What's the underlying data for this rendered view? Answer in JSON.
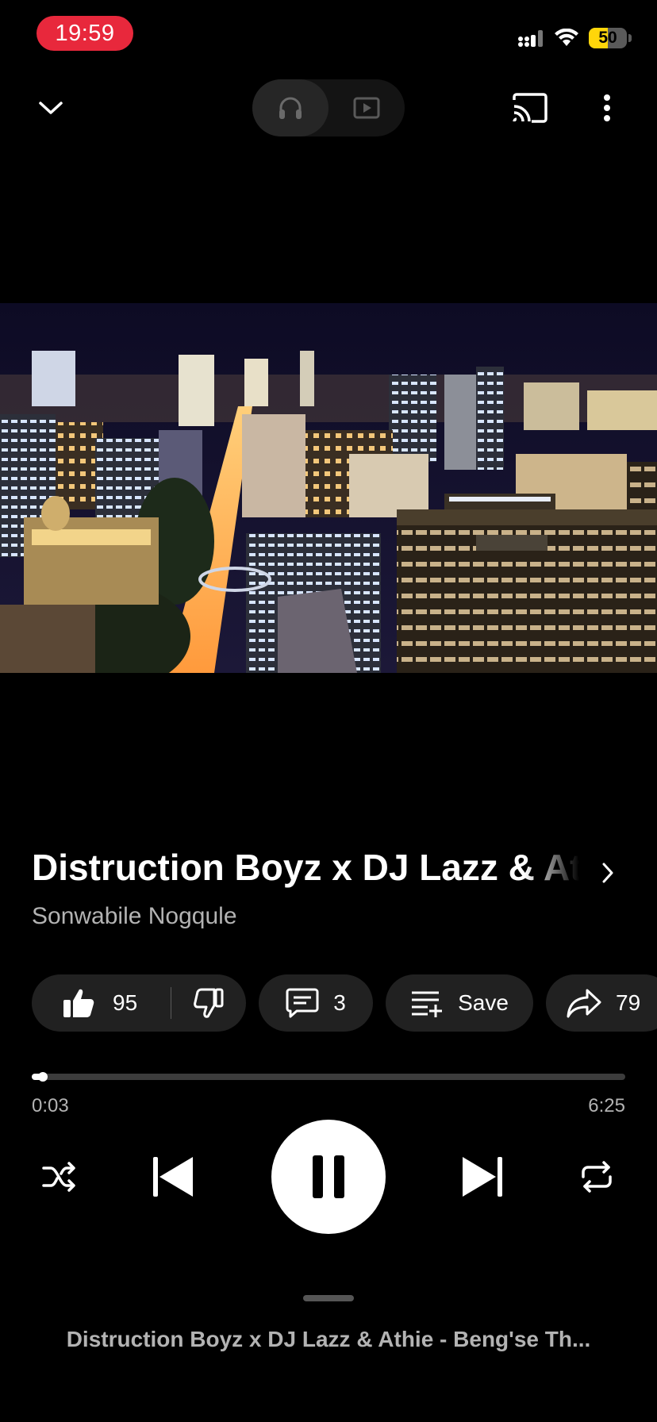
{
  "status_bar": {
    "time": "19:59",
    "battery_level": "50",
    "battery_fraction": 0.5,
    "battery_color": "#ffd60a",
    "time_pill_color": "#e8283c"
  },
  "toolbar": {
    "collapse_icon": "chevron-down-icon",
    "modes": [
      {
        "icon": "headphones-icon",
        "selected": true
      },
      {
        "icon": "video-icon",
        "selected": false
      }
    ],
    "cast_icon": "cast-icon",
    "more_icon": "more-vertical-icon"
  },
  "track": {
    "title": "Distruction Boyz x DJ Lazz & Athie - Beng'se Thina",
    "artist": "Sonwabile Nogqule"
  },
  "actions": {
    "likes": "95",
    "comments": "3",
    "save_label": "Save",
    "shares": "79"
  },
  "playback": {
    "elapsed": "0:03",
    "duration": "6:25",
    "progress_fraction": 0.0078,
    "state": "playing"
  },
  "up_next": {
    "text": "Distruction Boyz x DJ Lazz & Athie - Beng'se Th..."
  }
}
